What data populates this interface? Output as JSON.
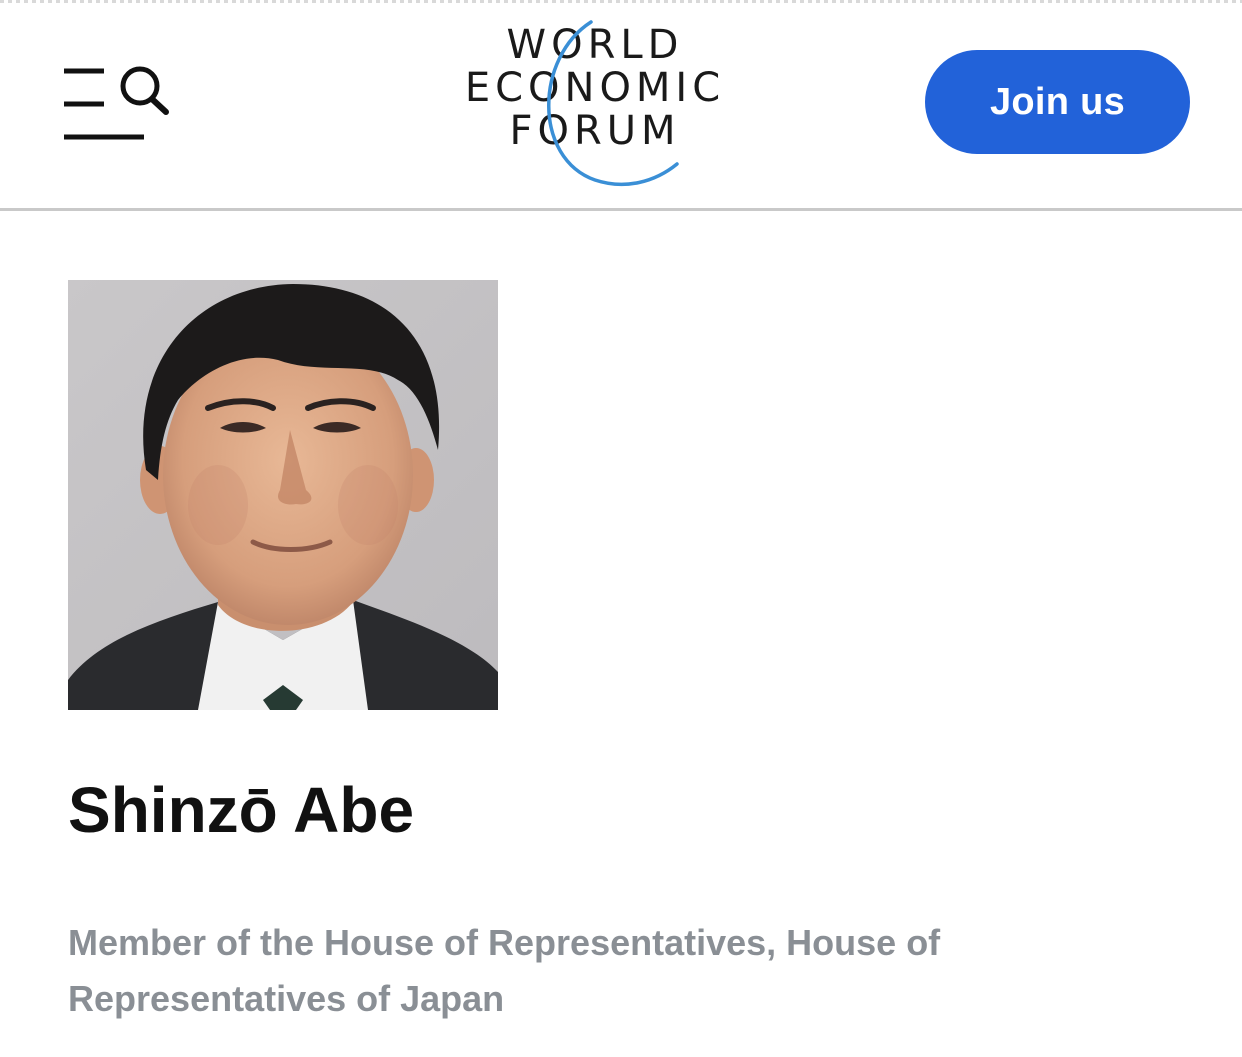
{
  "header": {
    "logo_lines": [
      "WORLD",
      "ECONOMIC",
      "FORUM"
    ],
    "join_label": "Join us",
    "menu_icon": "menu-search-icon"
  },
  "profile": {
    "name": "Shinzō Abe",
    "title": "Member of the House of Representatives, House of Representatives of Japan",
    "photo": "portrait-photo"
  },
  "colors": {
    "accent": "#2262d9",
    "logo_arc": "#3a8fd6",
    "title_text": "#8a8f95",
    "name_text": "#111111",
    "divider": "#c9c9c9"
  }
}
